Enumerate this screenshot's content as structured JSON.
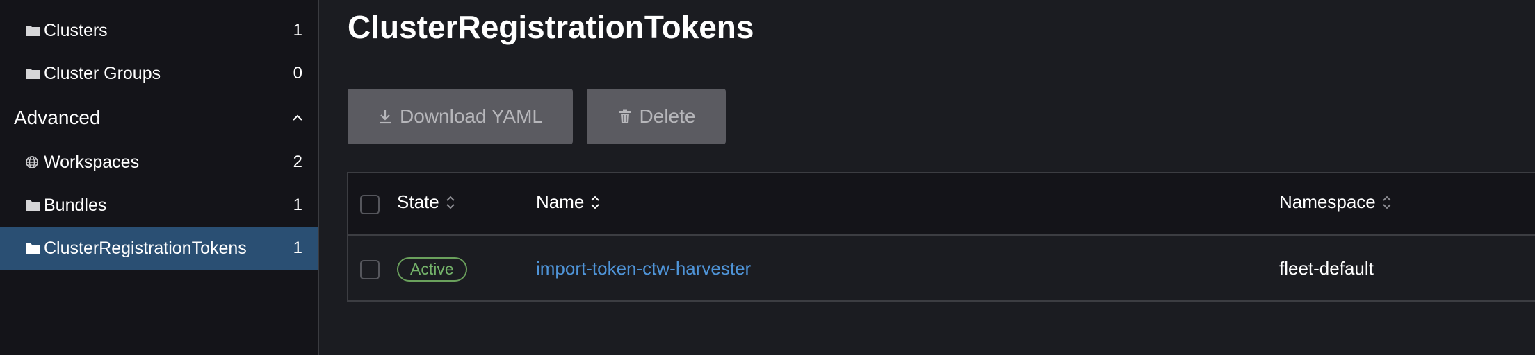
{
  "sidebar": {
    "items_top": [
      {
        "label": "Clusters",
        "count": "1",
        "icon": "folder-icon"
      },
      {
        "label": "Cluster Groups",
        "count": "0",
        "icon": "folder-icon"
      }
    ],
    "group": {
      "label": "Advanced",
      "expanded": true
    },
    "items_advanced": [
      {
        "label": "Workspaces",
        "count": "2",
        "icon": "globe-icon"
      },
      {
        "label": "Bundles",
        "count": "1",
        "icon": "folder-icon"
      },
      {
        "label": "ClusterRegistrationTokens",
        "count": "1",
        "icon": "folder-icon",
        "active": true
      }
    ]
  },
  "main": {
    "title": "ClusterRegistrationTokens",
    "toolbar": {
      "download_label": "Download YAML",
      "delete_label": "Delete"
    },
    "table": {
      "headers": {
        "state": "State",
        "name": "Name",
        "namespace": "Namespace"
      },
      "rows": [
        {
          "state": "Active",
          "name": "import-token-ctw-harvester",
          "namespace": "fleet-default"
        }
      ]
    }
  },
  "colors": {
    "sidebar_bg": "#141419",
    "page_bg": "#1b1c21",
    "active_item_bg": "#2a4f73",
    "button_bg": "#5b5b61",
    "link": "#4f94d8",
    "status_active": "#74b26a"
  }
}
